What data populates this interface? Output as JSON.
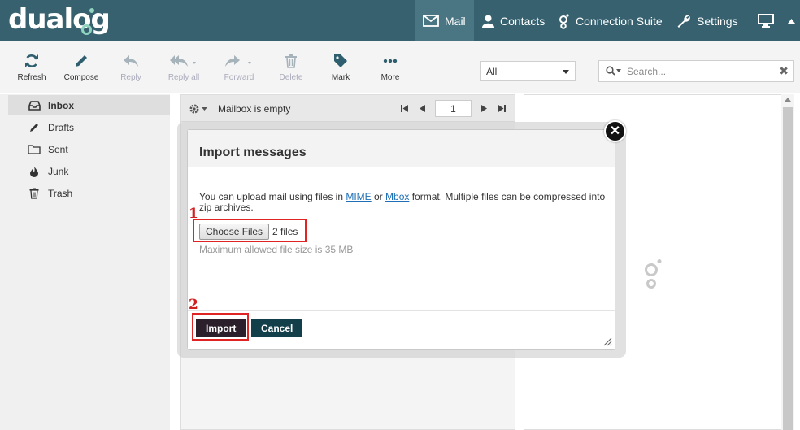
{
  "brand": {
    "logo_text": "dualog"
  },
  "nav": {
    "mail": "Mail",
    "contacts": "Contacts",
    "connection_suite": "Connection Suite",
    "settings": "Settings"
  },
  "toolbar": {
    "refresh": "Refresh",
    "compose": "Compose",
    "reply": "Reply",
    "reply_all": "Reply all",
    "forward": "Forward",
    "delete": "Delete",
    "mark": "Mark",
    "more": "More",
    "filter_value": "All",
    "search_placeholder": "Search..."
  },
  "folders": [
    {
      "label": "Inbox",
      "icon": "inbox-icon"
    },
    {
      "label": "Drafts",
      "icon": "pencil-icon"
    },
    {
      "label": "Sent",
      "icon": "folder-icon"
    },
    {
      "label": "Junk",
      "icon": "fire-icon"
    },
    {
      "label": "Trash",
      "icon": "trash-icon"
    }
  ],
  "message_list": {
    "status": "Mailbox is empty",
    "page": "1"
  },
  "modal": {
    "title": "Import messages",
    "text_before": "You can upload mail using files in ",
    "link_mime": "MIME",
    "text_or": " or ",
    "link_mbox": "Mbox",
    "text_after": " format. Multiple files can be compressed into zip archives.",
    "choose_files": "Choose Files",
    "files_count": "2 files",
    "max_size": "Maximum allowed file size is 35 MB",
    "import": "Import",
    "cancel": "Cancel"
  },
  "annotations": {
    "step1": "1",
    "step2": "2"
  },
  "colors": {
    "topbar": "#37616f",
    "nav_active": "#4a7583",
    "import_button": "#2b1f2c",
    "cancel_button": "#123f4a",
    "annotation_red": "#e02424",
    "link": "#1f6fb6"
  }
}
